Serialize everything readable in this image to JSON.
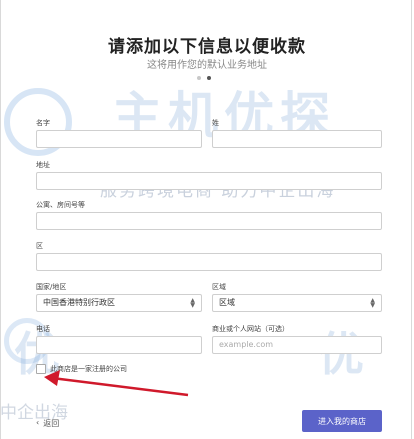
{
  "header": {
    "title": "请添加以下信息以便收款",
    "subtitle": "这将用作您的默认业务地址"
  },
  "steps": {
    "total": 2,
    "current": 2
  },
  "watermark": {
    "brand": "主机优探",
    "tagline": "服务跨境电商  助力中企出海",
    "bottom_text": "中企出海",
    "brand_part": "优"
  },
  "form": {
    "first_name": {
      "label": "名字",
      "value": ""
    },
    "last_name": {
      "label": "姓",
      "value": ""
    },
    "address": {
      "label": "地址",
      "value": ""
    },
    "apartment": {
      "label": "公寓、房间号等",
      "value": ""
    },
    "district": {
      "label": "区",
      "value": ""
    },
    "country": {
      "label": "国家/地区",
      "value": "中国香港特别行政区"
    },
    "region": {
      "label": "区域",
      "value": "区域"
    },
    "phone": {
      "label": "电话",
      "value": ""
    },
    "website": {
      "label": "商业或个人网站（可选）",
      "placeholder": "example.com"
    },
    "registered_company": {
      "label": "此商店是一家注册的公司",
      "checked": false
    }
  },
  "footer": {
    "back_label": "返回",
    "back_icon": "chevron-left-icon",
    "submit_label": "进入我的商店"
  },
  "colors": {
    "accent": "#5b63c9",
    "annotation_arrow": "#d0192b"
  }
}
